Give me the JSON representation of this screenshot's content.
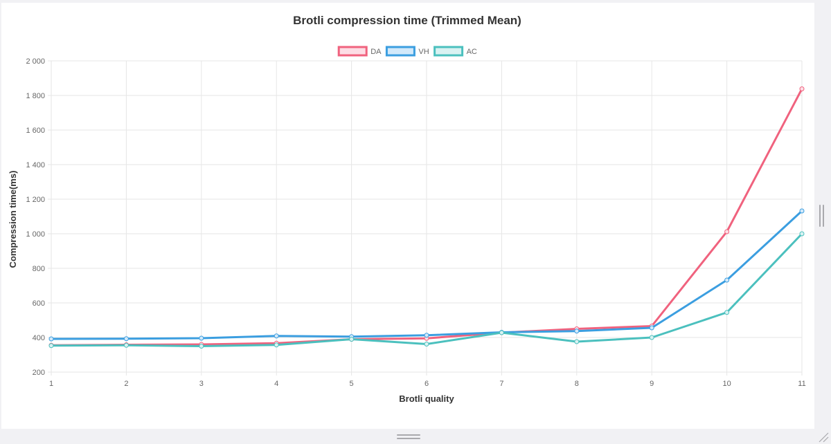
{
  "chart_data": {
    "type": "line",
    "title": "Brotli compression time (Trimmed Mean)",
    "xlabel": "Brotli quality",
    "ylabel": "Compression time(ms)",
    "x": [
      1,
      2,
      3,
      4,
      5,
      6,
      7,
      8,
      9,
      10,
      11
    ],
    "x_tick_labels": [
      "1",
      "2",
      "3",
      "4",
      "5",
      "6",
      "7",
      "8",
      "9",
      "10",
      "11"
    ],
    "ylim": [
      200,
      2000
    ],
    "y_ticks": [
      200,
      400,
      600,
      800,
      1000,
      1200,
      1400,
      1600,
      1800,
      2000
    ],
    "y_tick_labels": [
      "200",
      "400",
      "600",
      "800",
      "1 000",
      "1 200",
      "1 400",
      "1 600",
      "1 800",
      "2 000"
    ],
    "grid": true,
    "legend_position": "top-center",
    "series": [
      {
        "name": "DA",
        "color": "#f0627e",
        "fill": "#fddde5",
        "values": [
          355,
          358,
          360,
          367,
          390,
          395,
          428,
          450,
          466,
          1012,
          1838
        ]
      },
      {
        "name": "VH",
        "color": "#3b9ee0",
        "fill": "#d2e9fa",
        "values": [
          392,
          393,
          396,
          409,
          405,
          413,
          430,
          437,
          456,
          732,
          1132
        ]
      },
      {
        "name": "AC",
        "color": "#4bc0be",
        "fill": "#d9f2f2",
        "values": [
          353,
          355,
          350,
          357,
          390,
          362,
          428,
          376,
          400,
          545,
          1000
        ]
      }
    ]
  }
}
